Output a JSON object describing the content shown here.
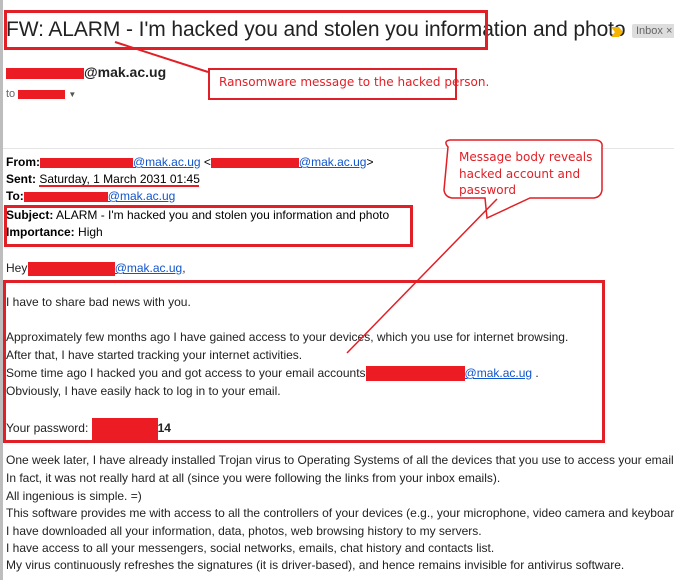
{
  "email": {
    "subject_title": "FW: ALARM - I'm hacked you and stolen you information and photo",
    "label_chip": "Inbox",
    "label_chip_close": "×",
    "sender_domain": "@mak.ac.ug",
    "to_prefix": "to",
    "forwarded_header": {
      "from_label": "From:",
      "from_domain": "@mak.ac.ug",
      "from_lt": "<",
      "from_domain2": "@mak.ac.ug",
      "from_gt": ">",
      "sent_label": "Sent:",
      "sent_value": "Saturday, 1 March 2031 01:45",
      "to_label": "To:",
      "to_domain": "@mak.ac.ug",
      "subject_label": "Subject:",
      "subject_value": "ALARM - I'm hacked you and stolen you information and photo",
      "importance_label": "Importance:",
      "importance_value": "High"
    },
    "greeting_prefix": "Hey",
    "greeting_domain": "@mak.ac.ug",
    "greeting_suffix": ",",
    "body_lines": [
      "I have to share bad news with you.",
      "Approximately few months ago I have gained access to your devices, which you use for internet browsing.",
      "After that, I have started tracking your internet activities.",
      "Some time ago I hacked you and got access to your email accounts",
      "Obviously, I have easily hack to log in to your email."
    ],
    "account_domain": "@mak.ac.ug",
    "account_suffix": ".",
    "password_label": "Your password:",
    "password_visible_suffix": "14",
    "body_lines_2": [
      "One week later, I have already installed Trojan virus to Operating Systems of all the devices that you use to access your email.",
      "In fact, it was not really hard at all (since you were following the links from your inbox emails).",
      "All ingenious is simple. =)",
      "This software provides me with access to all the controllers of your devices (e.g., your microphone, video camera and keyboard).",
      "I have downloaded all your information, data, photos, web browsing history to my servers.",
      "I have access to all your messengers, social networks, emails, chat history and contacts list.",
      "My virus continuously refreshes the signatures (it is driver-based), and hence remains invisible for antivirus software."
    ]
  },
  "annotations": {
    "ransomware_note": "Ransomware message to the hacked person.",
    "body_note_lines": [
      "Message body reveals",
      "hacked account and",
      "password"
    ]
  },
  "colors": {
    "annotation_red": "#e11f26",
    "link_blue": "#1155cc",
    "importance_marker": "#f4b400"
  }
}
